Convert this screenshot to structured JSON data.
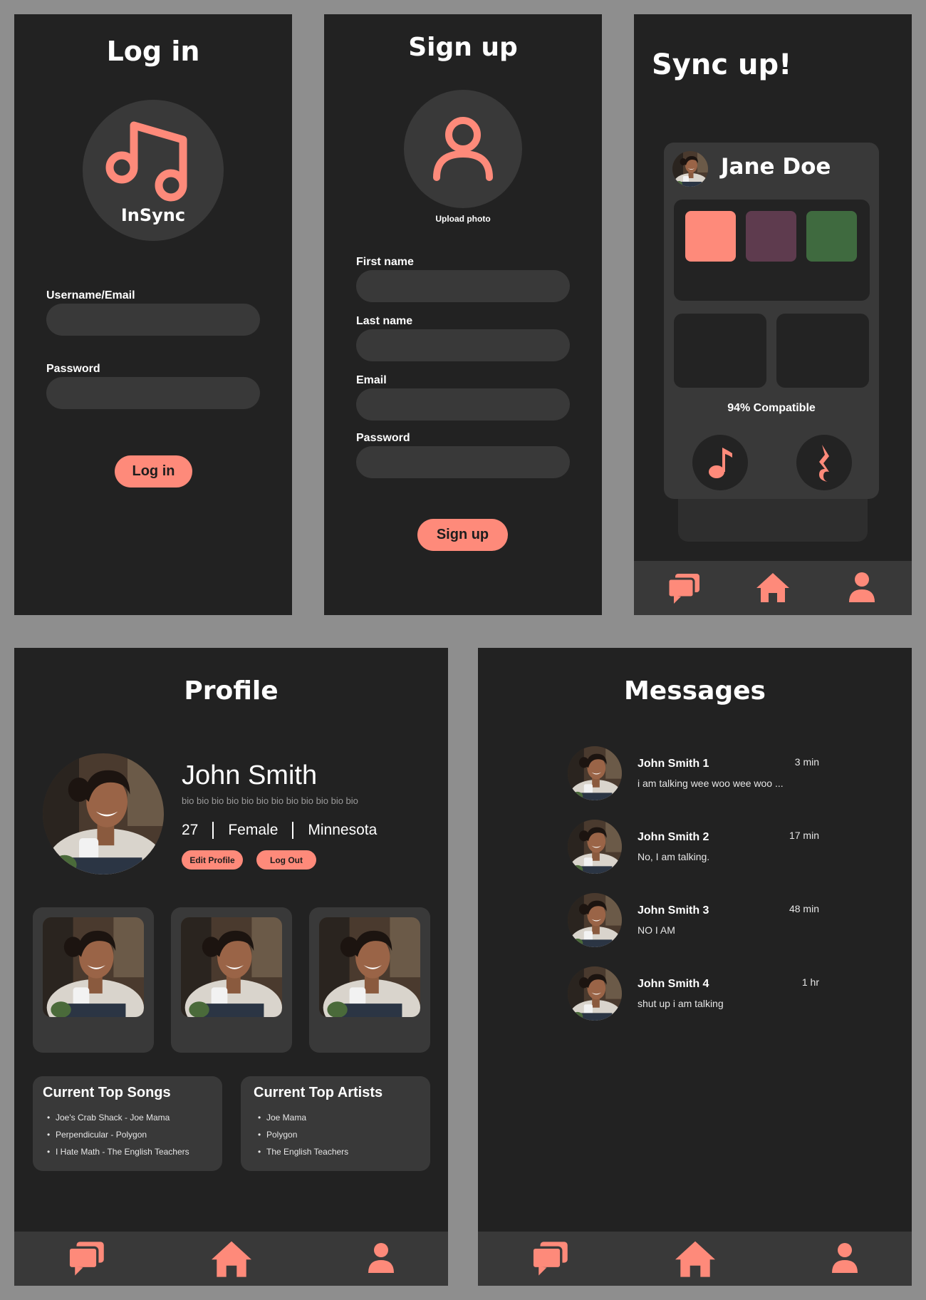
{
  "login": {
    "title": "Log in",
    "app_name": "InSync",
    "username_label": "Username/Email",
    "username_value": "",
    "password_label": "Password",
    "password_value": "",
    "button_label": "Log in",
    "logo_icon": "music-note-icon"
  },
  "signup": {
    "title": "Sign up",
    "upload_label": "Upload photo",
    "fields": [
      {
        "label": "First name",
        "value": ""
      },
      {
        "label": "Last name",
        "value": ""
      },
      {
        "label": "Email",
        "value": ""
      },
      {
        "label": "Password",
        "value": ""
      }
    ],
    "button_label": "Sign up"
  },
  "syncup": {
    "title": "Sync up!",
    "card": {
      "name": "Jane Doe",
      "swatches": [
        "#fe8a7a",
        "#5e3b4e",
        "#3f6a3f"
      ],
      "compatibility": "94% Compatible",
      "left_action_icon": "music-note-icon",
      "right_action_icon": "quarter-rest-icon"
    }
  },
  "profile": {
    "title": "Profile",
    "name": "John Smith",
    "bio": "bio bio bio bio bio bio bio bio bio bio bio bio",
    "age": "27",
    "gender": "Female",
    "location": "Minnesota",
    "edit_label": "Edit Profile",
    "logout_label": "Log Out",
    "top_songs": {
      "title": "Current Top Songs",
      "items": [
        "Joe's Crab Shack - Joe Mama",
        "Perpendicular - Polygon",
        "I Hate Math - The English Teachers"
      ]
    },
    "top_artists": {
      "title": "Current Top Artists",
      "items": [
        "Joe Mama",
        "Polygon",
        "The English Teachers"
      ]
    }
  },
  "messages": {
    "title": "Messages",
    "threads": [
      {
        "name": "John Smith 1",
        "preview": "i am talking wee woo wee woo ...",
        "time": "3 min"
      },
      {
        "name": "John Smith 2",
        "preview": "No, I am talking.",
        "time": "17 min"
      },
      {
        "name": "John Smith 3",
        "preview": "NO I AM",
        "time": "48 min"
      },
      {
        "name": "John Smith 4",
        "preview": "shut up i am talking",
        "time": "1 hr"
      }
    ]
  },
  "nav": {
    "messages_icon": "chat-bubbles-icon",
    "home_icon": "home-icon",
    "profile_icon": "person-icon"
  },
  "colors": {
    "accent": "#fe8a7a",
    "background": "#222222",
    "surface": "#393939",
    "page": "#8e8e8e"
  }
}
